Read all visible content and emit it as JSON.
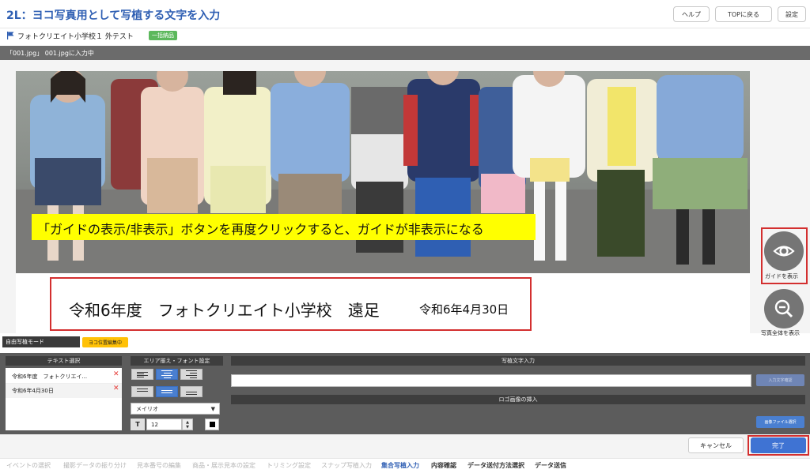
{
  "header": {
    "title": "2L：ヨコ写真用として写植する文字を入力",
    "help_label": "ヘルプ",
    "top_label": "TOPに戻る",
    "settings_label": "設定"
  },
  "project": {
    "name": "フォトクリエイト小学校１ 外テスト",
    "badge": "一括納品"
  },
  "file_status": "「001.jpg」 001.jpgに入力中",
  "guide_text": "「ガイドの表示/非表示」ボタンを再度クリックすると、ガイドが非表示になる",
  "print_text": {
    "line1": "令和6年度　フォトクリエイト小学校　遠足",
    "line2": "令和6年4月30日"
  },
  "side": {
    "show_guide_label": "ガイドを表示",
    "fit_photo_label": "写真全体を表示"
  },
  "mode": {
    "label": "自由写植モード",
    "badge": "ヨコ位置編集中"
  },
  "panel": {
    "text_select_header": "テキスト選択",
    "texts": [
      "令和6年度　フォトクリエイ...",
      "令和6年4月30日"
    ],
    "area_header": "エリア揃え・フォント設定",
    "font": "メイリオ",
    "font_size": "12",
    "size_icon": "T",
    "text_input_header": "写植文字入力",
    "text_input_value": "",
    "input_confirm_label": "入力文字確認",
    "logo_header": "ロゴ画像の挿入",
    "image_select_label": "画像ファイル選択"
  },
  "actions": {
    "cancel_label": "キャンセル",
    "done_label": "完了"
  },
  "steps": [
    {
      "label": "イベントの選択",
      "state": "done"
    },
    {
      "label": "撮影データの振り分け",
      "state": "done"
    },
    {
      "label": "見本番号の編集",
      "state": "done"
    },
    {
      "label": "商品・展示見本の設定",
      "state": "done"
    },
    {
      "label": "トリミング設定",
      "state": "done"
    },
    {
      "label": "スナップ写植入力",
      "state": "done"
    },
    {
      "label": "集合写植入力",
      "state": "current"
    },
    {
      "label": "内容確認",
      "state": "todo"
    },
    {
      "label": "データ送付方法選択",
      "state": "todo"
    },
    {
      "label": "データ送信",
      "state": "todo"
    }
  ],
  "colors": {
    "accent": "#3f73d3",
    "highlight": "#ff0000",
    "guide_background": "#ffff00"
  }
}
